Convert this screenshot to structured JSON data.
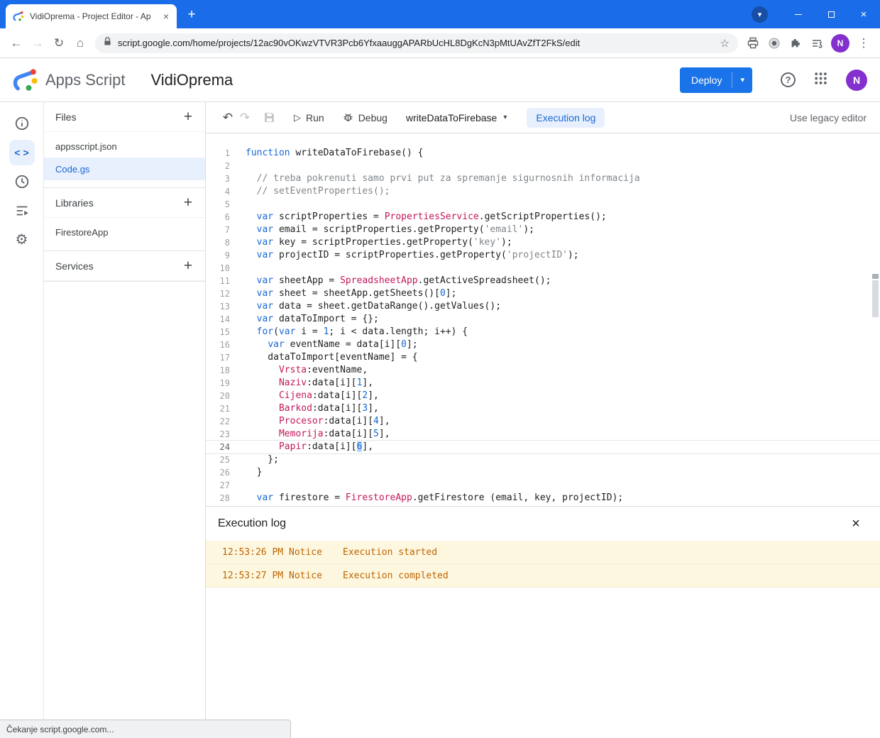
{
  "browser": {
    "tab": {
      "title": "VidiOprema - Project Editor - Ap"
    },
    "url": "script.google.com/home/projects/12ac90vOKwzVTVR3Pcb6YfxaauggAPARbUcHL8DgKcN3pMtUAvZfT2FkS/edit",
    "status_text": "Čekanje script.google.com...",
    "avatar_initial": "N"
  },
  "header": {
    "product_name": "Apps Script",
    "project_title": "VidiOprema",
    "deploy_button": "Deploy",
    "avatar_initial": "N"
  },
  "files_panel": {
    "files_header": "Files",
    "files": [
      {
        "name": "appsscript.json",
        "selected": false
      },
      {
        "name": "Code.gs",
        "selected": true
      }
    ],
    "libraries_header": "Libraries",
    "libraries": [
      "FirestoreApp"
    ],
    "services_header": "Services"
  },
  "toolbar": {
    "run_label": "Run",
    "debug_label": "Debug",
    "function_name": "writeDataToFirebase",
    "execution_log_button": "Execution log",
    "legacy_editor_label": "Use legacy editor"
  },
  "code": {
    "lines": [
      {
        "n": 1,
        "tokens": [
          [
            "kw",
            "function"
          ],
          [
            "pl",
            " writeDataToFirebase() {"
          ]
        ]
      },
      {
        "n": 2,
        "tokens": []
      },
      {
        "n": 3,
        "tokens": [
          [
            "com",
            "  // treba pokrenuti samo prvi put za spremanje sigurnosnih informacija"
          ]
        ]
      },
      {
        "n": 4,
        "tokens": [
          [
            "com",
            "  // setEventProperties();"
          ]
        ]
      },
      {
        "n": 5,
        "tokens": []
      },
      {
        "n": 6,
        "tokens": [
          [
            "pl",
            "  "
          ],
          [
            "kw",
            "var"
          ],
          [
            "pl",
            " scriptProperties = "
          ],
          [
            "cl",
            "PropertiesService"
          ],
          [
            "pl",
            ".getScriptProperties();"
          ]
        ]
      },
      {
        "n": 7,
        "tokens": [
          [
            "pl",
            "  "
          ],
          [
            "kw",
            "var"
          ],
          [
            "pl",
            " email = scriptProperties.getProperty("
          ],
          [
            "str",
            "'email'"
          ],
          [
            "pl",
            ");"
          ]
        ]
      },
      {
        "n": 8,
        "tokens": [
          [
            "pl",
            "  "
          ],
          [
            "kw",
            "var"
          ],
          [
            "pl",
            " key = scriptProperties.getProperty("
          ],
          [
            "str",
            "'key'"
          ],
          [
            "pl",
            ");"
          ]
        ]
      },
      {
        "n": 9,
        "tokens": [
          [
            "pl",
            "  "
          ],
          [
            "kw",
            "var"
          ],
          [
            "pl",
            " projectID = scriptProperties.getProperty("
          ],
          [
            "str",
            "'projectID'"
          ],
          [
            "pl",
            ");"
          ]
        ]
      },
      {
        "n": 10,
        "tokens": []
      },
      {
        "n": 11,
        "tokens": [
          [
            "pl",
            "  "
          ],
          [
            "kw",
            "var"
          ],
          [
            "pl",
            " sheetApp = "
          ],
          [
            "cl",
            "SpreadsheetApp"
          ],
          [
            "pl",
            ".getActiveSpreadsheet();"
          ]
        ]
      },
      {
        "n": 12,
        "tokens": [
          [
            "pl",
            "  "
          ],
          [
            "kw",
            "var"
          ],
          [
            "pl",
            " sheet = sheetApp.getSheets()["
          ],
          [
            "num",
            "0"
          ],
          [
            "pl",
            "];"
          ]
        ]
      },
      {
        "n": 13,
        "tokens": [
          [
            "pl",
            "  "
          ],
          [
            "kw",
            "var"
          ],
          [
            "pl",
            " data = sheet.getDataRange().getValues();"
          ]
        ]
      },
      {
        "n": 14,
        "tokens": [
          [
            "pl",
            "  "
          ],
          [
            "kw",
            "var"
          ],
          [
            "pl",
            " dataToImport = {};"
          ]
        ]
      },
      {
        "n": 15,
        "tokens": [
          [
            "pl",
            "  "
          ],
          [
            "kw",
            "for"
          ],
          [
            "pl",
            "("
          ],
          [
            "kw",
            "var"
          ],
          [
            "pl",
            " i = "
          ],
          [
            "num",
            "1"
          ],
          [
            "pl",
            "; i < data.length; i++) {"
          ]
        ]
      },
      {
        "n": 16,
        "tokens": [
          [
            "pl",
            "    "
          ],
          [
            "kw",
            "var"
          ],
          [
            "pl",
            " eventName = data[i]["
          ],
          [
            "num",
            "0"
          ],
          [
            "pl",
            "];"
          ]
        ]
      },
      {
        "n": 17,
        "tokens": [
          [
            "pl",
            "    dataToImport[eventName] = {"
          ]
        ]
      },
      {
        "n": 18,
        "tokens": [
          [
            "pl",
            "      "
          ],
          [
            "cl",
            "Vrsta"
          ],
          [
            "pl",
            ":eventName,"
          ]
        ]
      },
      {
        "n": 19,
        "tokens": [
          [
            "pl",
            "      "
          ],
          [
            "cl",
            "Naziv"
          ],
          [
            "pl",
            ":data[i]["
          ],
          [
            "num",
            "1"
          ],
          [
            "pl",
            "],"
          ]
        ]
      },
      {
        "n": 20,
        "tokens": [
          [
            "pl",
            "      "
          ],
          [
            "cl",
            "Cijena"
          ],
          [
            "pl",
            ":data[i]["
          ],
          [
            "num",
            "2"
          ],
          [
            "pl",
            "],"
          ]
        ]
      },
      {
        "n": 21,
        "tokens": [
          [
            "pl",
            "      "
          ],
          [
            "cl",
            "Barkod"
          ],
          [
            "pl",
            ":data[i]["
          ],
          [
            "num",
            "3"
          ],
          [
            "pl",
            "],"
          ]
        ]
      },
      {
        "n": 22,
        "tokens": [
          [
            "pl",
            "      "
          ],
          [
            "cl",
            "Procesor"
          ],
          [
            "pl",
            ":data[i]["
          ],
          [
            "num",
            "4"
          ],
          [
            "pl",
            "],"
          ]
        ]
      },
      {
        "n": 23,
        "tokens": [
          [
            "pl",
            "      "
          ],
          [
            "cl",
            "Memorija"
          ],
          [
            "pl",
            ":data[i]["
          ],
          [
            "num",
            "5"
          ],
          [
            "pl",
            "],"
          ]
        ]
      },
      {
        "n": 24,
        "current": true,
        "tokens": [
          [
            "pl",
            "      "
          ],
          [
            "cl",
            "Papir"
          ],
          [
            "pl",
            ":data[i]["
          ],
          [
            "sel",
            "6"
          ],
          [
            "pl",
            "],"
          ]
        ]
      },
      {
        "n": 25,
        "tokens": [
          [
            "pl",
            "    };"
          ]
        ]
      },
      {
        "n": 26,
        "tokens": [
          [
            "pl",
            "  }"
          ]
        ]
      },
      {
        "n": 27,
        "tokens": []
      },
      {
        "n": 28,
        "tokens": [
          [
            "pl",
            "  "
          ],
          [
            "kw",
            "var"
          ],
          [
            "pl",
            " firestore = "
          ],
          [
            "cl",
            "FirestoreApp"
          ],
          [
            "pl",
            ".getFirestore (email, key, projectID);"
          ]
        ]
      }
    ]
  },
  "execution_log": {
    "title": "Execution log",
    "entries": [
      {
        "time": "12:53:26 PM",
        "level": "Notice",
        "message": "Execution started"
      },
      {
        "time": "12:53:27 PM",
        "level": "Notice",
        "message": "Execution completed"
      }
    ]
  },
  "icons": {
    "plus": "+",
    "back": "←",
    "forward": "→",
    "reload": "↻",
    "home": "⌂",
    "star": "☆",
    "kebab": "⋮",
    "new_tab": "+",
    "window_close": "×",
    "tab_close": "×",
    "update_caret": "▾",
    "undo": "↶",
    "redo": "↷",
    "run": "▷",
    "caret_down": "▾",
    "code": "< >",
    "gear": "⚙",
    "help": "?",
    "panel_close": "×"
  },
  "colors": {
    "titlebar_blue": "#1b6ce8",
    "accent_blue": "#1a73e8",
    "chip_bg": "#e8f0fe",
    "chip_text": "#1967d2",
    "keyword": "#1967d2",
    "identifier_pink": "#c2185b",
    "comment_gray": "#80868b",
    "log_row_bg": "#fef7e0",
    "log_text_orange": "#bd6500",
    "avatar_purple": "#8430ce"
  }
}
